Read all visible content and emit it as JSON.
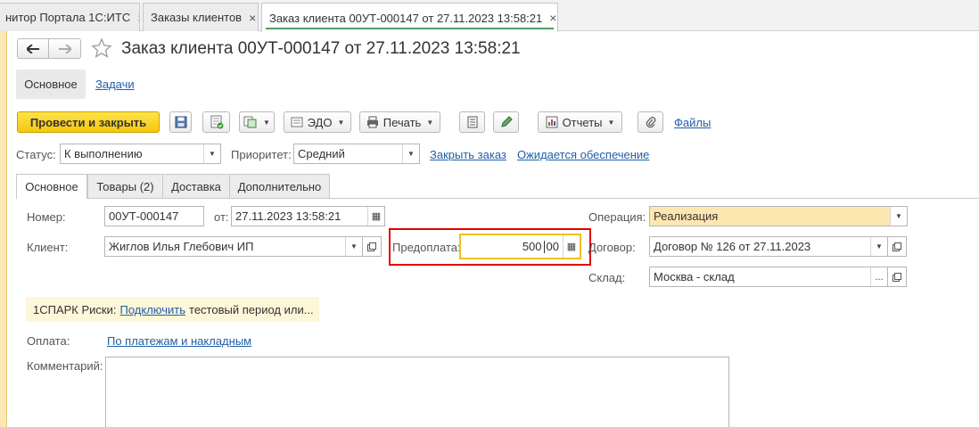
{
  "window_tabs": [
    {
      "label": "нитор Портала 1С:ИТС",
      "close": "×"
    },
    {
      "label": "Заказы клиентов",
      "close": "×"
    },
    {
      "label": "Заказ клиента 00УТ-000147 от 27.11.2023 13:58:21",
      "close": "×"
    }
  ],
  "header": {
    "title": "Заказ клиента 00УТ-000147 от 27.11.2023 13:58:21",
    "back_icon": "arrow-left-icon",
    "forward_icon": "arrow-right-icon",
    "star_icon": "star-outline-icon"
  },
  "sections": {
    "main": "Основное",
    "tasks": "Задачи"
  },
  "toolbar": {
    "post_close": "Провести и закрыть",
    "edo": "ЭДО",
    "print": "Печать",
    "reports": "Отчеты",
    "files": "Файлы"
  },
  "status_row": {
    "status_label": "Статус:",
    "status_value": "К выполнению",
    "priority_label": "Приоритет:",
    "priority_value": "Средний",
    "close_order": "Закрыть заказ",
    "awaiting": "Ожидается обеспечение"
  },
  "form_tabs": [
    "Основное",
    "Товары (2)",
    "Доставка",
    "Дополнительно"
  ],
  "fields": {
    "number_label": "Номер:",
    "number_value": "00УТ-000147",
    "from_label": "от:",
    "date_value": "27.11.2023 13:58:21",
    "operation_label": "Операция:",
    "operation_value": "Реализация",
    "client_label": "Клиент:",
    "client_value": "Жиглов Илья Глебович ИП",
    "prepay_label": "Предоплата:",
    "prepay_int": "500",
    "prepay_frac": "00",
    "contract_label": "Договор:",
    "contract_value": "Договор № 126 от 27.11.2023",
    "warehouse_label": "Склад:",
    "warehouse_value": "Москва - склад",
    "warehouse_more": "...",
    "payment_label": "Оплата:",
    "payment_link": "По платежам и накладным",
    "comment_label": "Комментарий:"
  },
  "spark": {
    "prefix": "1СПАРК Риски:",
    "link": "Подключить",
    "suffix": "тестовый период или..."
  },
  "colors": {
    "accent_yellow": "#f4c70c",
    "highlight_red": "#e00000",
    "link_blue": "#1f5fa8",
    "operation_bg": "#fde7b0"
  }
}
